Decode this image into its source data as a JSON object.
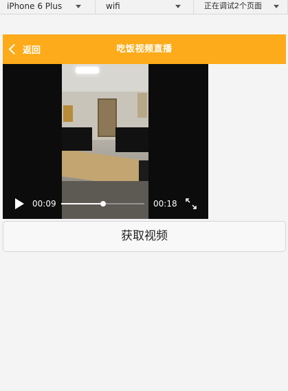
{
  "toolbar": {
    "device": "iPhone 6 Plus",
    "network": "wifi",
    "debug_pages": "正在调试2个页面"
  },
  "navbar": {
    "back_label": "返回",
    "title": "吃饭视频直播"
  },
  "player": {
    "current_time": "00:09",
    "duration": "00:18",
    "progress": 0.5
  },
  "actions": {
    "get_video_label": "获取视频"
  },
  "colors": {
    "accent": "#fdab1a",
    "player_background": "#0c0c0c",
    "page_background": "#f4f4f4"
  },
  "icons": {
    "back": "chevron-left-icon",
    "play": "play-icon",
    "fullscreen": "fullscreen-icon"
  }
}
